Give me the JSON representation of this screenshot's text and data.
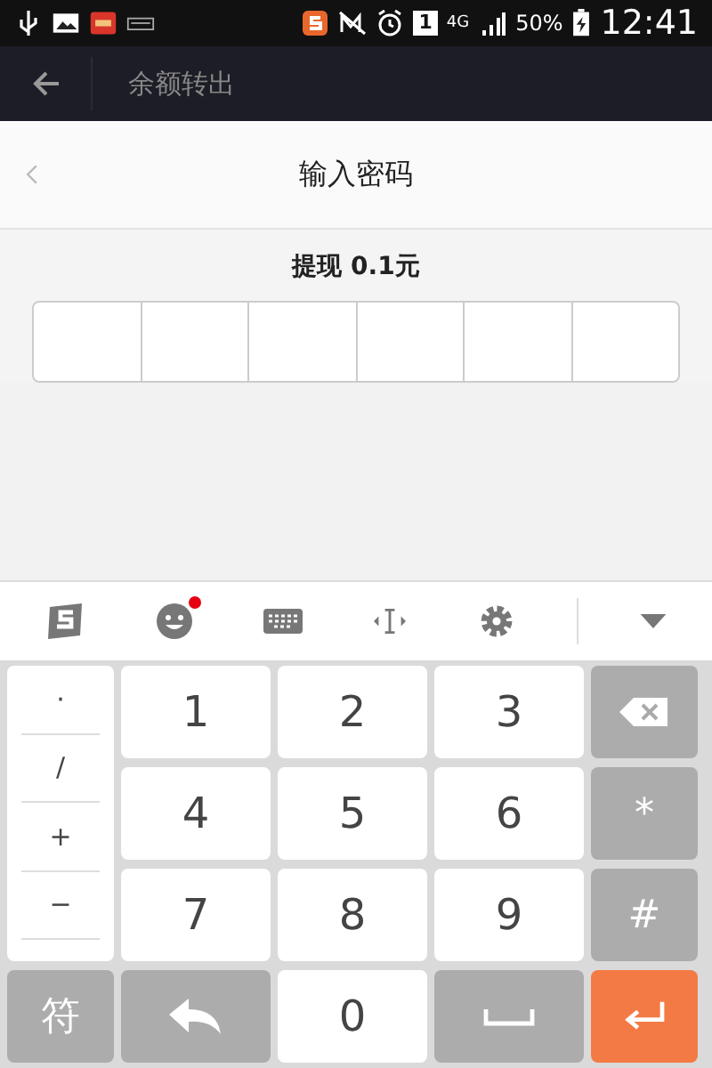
{
  "status_bar": {
    "sim": "1",
    "network": "4G",
    "battery": "50%",
    "time": "12:41"
  },
  "app_bar": {
    "title": "余额转出"
  },
  "dialog": {
    "title": "输入密码",
    "amount": "提现 0.1元",
    "pin_cells": [
      {
        "filled": false
      },
      {
        "filled": false
      },
      {
        "filled": false
      },
      {
        "filled": false
      },
      {
        "filled": false
      },
      {
        "filled": false
      }
    ]
  },
  "toolbar": [
    {
      "kind": "logo",
      "badge": false
    },
    {
      "kind": "emoji",
      "badge": true
    },
    {
      "kind": "keyboard",
      "badge": false
    },
    {
      "kind": "cursor",
      "badge": false
    },
    {
      "kind": "settings",
      "badge": false
    },
    {
      "kind": "collapse",
      "badge": false
    }
  ],
  "keyboard": {
    "symbols": [
      "·",
      "/",
      "+",
      "−"
    ],
    "keys": [
      {
        "kind": "digit",
        "label": "1"
      },
      {
        "kind": "digit",
        "label": "2"
      },
      {
        "kind": "digit",
        "label": "3"
      },
      {
        "kind": "backspace"
      },
      {
        "kind": "digit",
        "label": "4"
      },
      {
        "kind": "digit",
        "label": "5"
      },
      {
        "kind": "digit",
        "label": "6"
      },
      {
        "kind": "function",
        "label": "*"
      },
      {
        "kind": "digit",
        "label": "7"
      },
      {
        "kind": "digit",
        "label": "8"
      },
      {
        "kind": "digit",
        "label": "9"
      },
      {
        "kind": "function",
        "label": "#"
      },
      {
        "kind": "function",
        "label": "符"
      },
      {
        "kind": "return"
      },
      {
        "kind": "digit",
        "label": "0"
      },
      {
        "kind": "space"
      },
      {
        "kind": "enter"
      }
    ]
  }
}
